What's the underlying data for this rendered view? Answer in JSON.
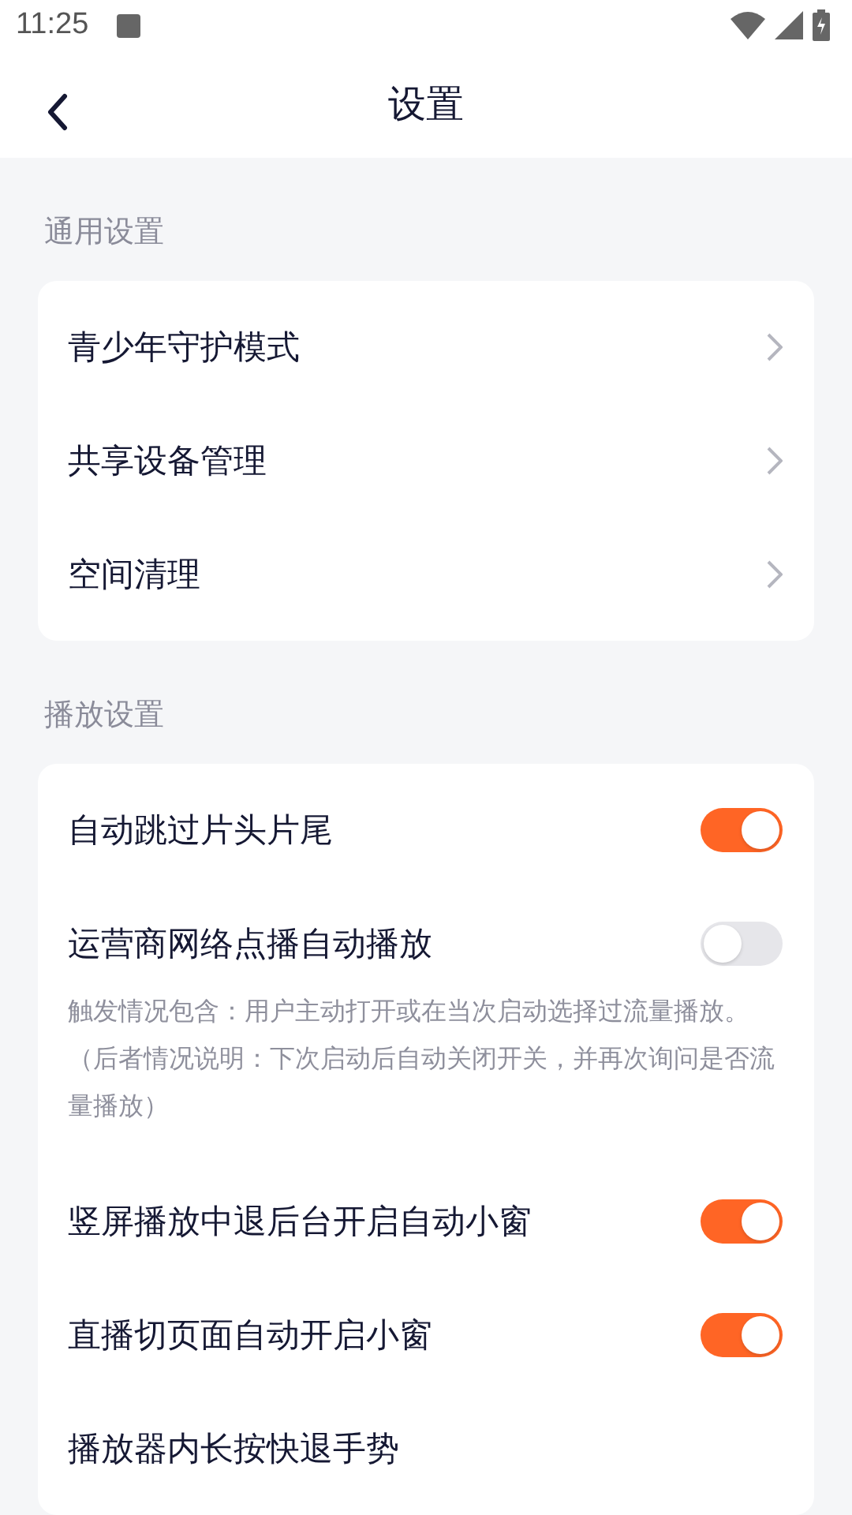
{
  "status_bar": {
    "time": "11:25"
  },
  "header": {
    "title": "设置"
  },
  "sections": [
    {
      "title": "通用设置",
      "items": [
        {
          "kind": "link",
          "label": "青少年守护模式"
        },
        {
          "kind": "link",
          "label": "共享设备管理"
        },
        {
          "kind": "link",
          "label": "空间清理"
        }
      ]
    },
    {
      "title": "播放设置",
      "items": [
        {
          "kind": "toggle",
          "label": "自动跳过片头片尾",
          "on": true
        },
        {
          "kind": "toggle",
          "label": "运营商网络点播自动播放",
          "on": false,
          "note": "触发情况包含：用户主动打开或在当次启动选择过流量播放。（后者情况说明：下次启动后自动关闭开关，并再次询问是否流量播放）"
        },
        {
          "kind": "toggle",
          "label": "竖屏播放中退后台开启自动小窗",
          "on": true
        },
        {
          "kind": "toggle",
          "label": "直播切页面自动开启小窗",
          "on": true
        },
        {
          "kind": "plain",
          "label": "播放器内长按快退手势"
        }
      ]
    }
  ]
}
